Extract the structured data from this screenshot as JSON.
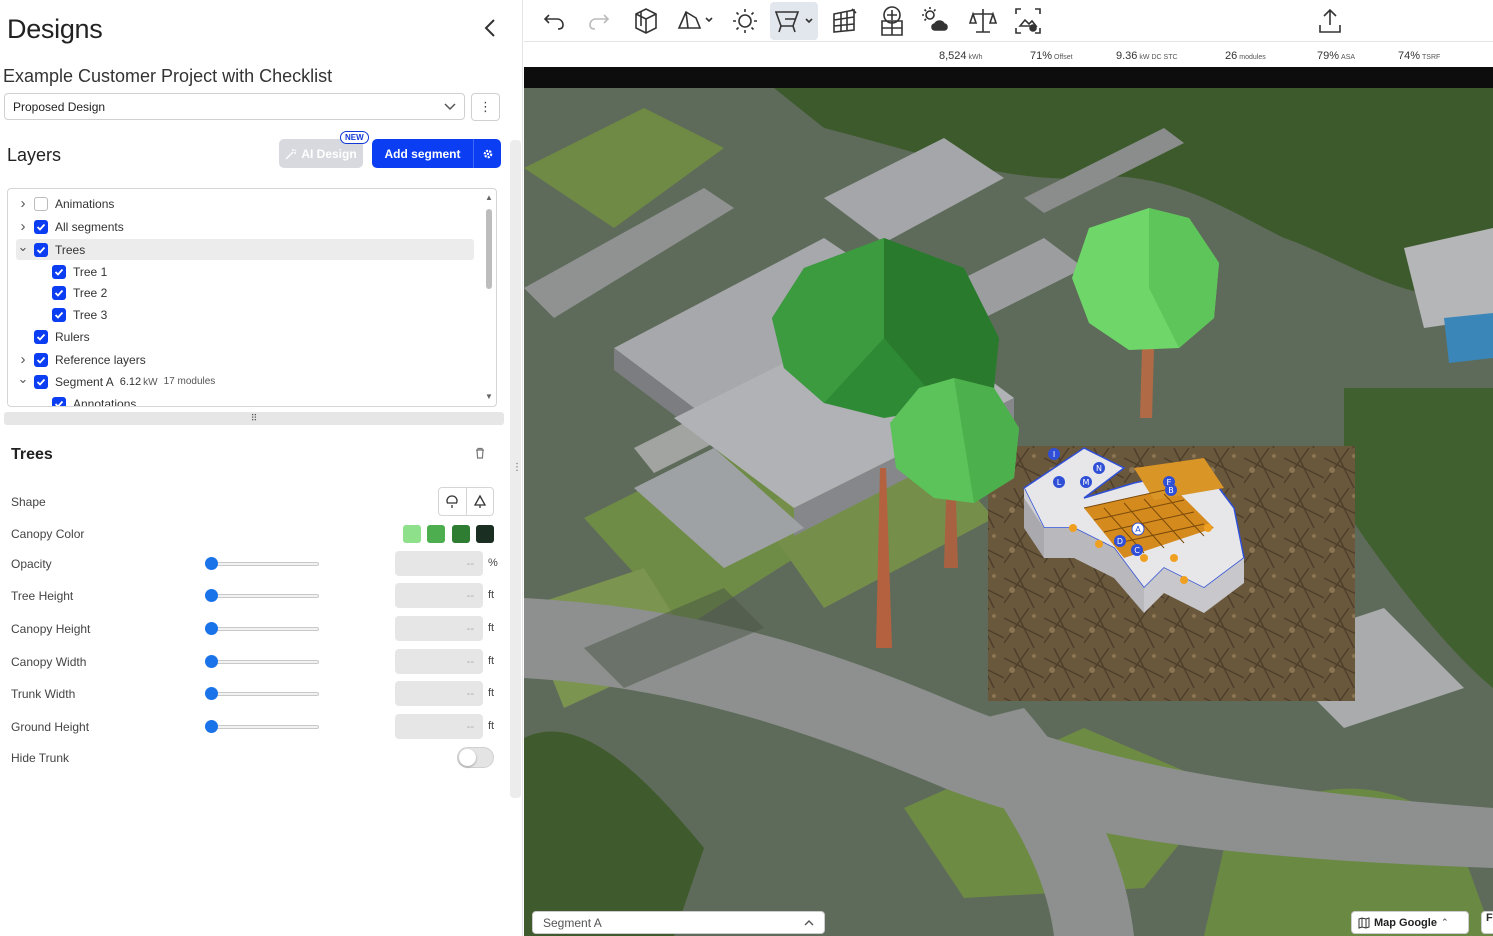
{
  "header": {
    "title": "Designs",
    "project_name": "Example Customer Project with Checklist"
  },
  "design_select": {
    "value": "Proposed Design"
  },
  "layers": {
    "title": "Layers",
    "ai_design_label": "AI Design",
    "new_badge": "NEW",
    "add_segment_label": "Add segment",
    "items": [
      {
        "label": "Animations",
        "checked": false,
        "expand": "collapsed"
      },
      {
        "label": "All segments",
        "checked": true,
        "expand": "collapsed"
      },
      {
        "label": "Trees",
        "checked": true,
        "expand": "expanded",
        "selected": true
      },
      {
        "label": "Tree 1",
        "checked": true,
        "expand": "none"
      },
      {
        "label": "Tree 2",
        "checked": true,
        "expand": "none"
      },
      {
        "label": "Tree 3",
        "checked": true,
        "expand": "none"
      },
      {
        "label": "Rulers",
        "checked": true,
        "expand": "none"
      },
      {
        "label": "Reference layers",
        "checked": true,
        "expand": "collapsed"
      },
      {
        "label": "Segment A",
        "checked": true,
        "expand": "expanded",
        "kw": "6.12",
        "kw_unit": "kW",
        "modules": "17 modules"
      },
      {
        "label": "Annotations",
        "checked": true,
        "expand": "none"
      }
    ]
  },
  "properties": {
    "title": "Trees",
    "shape_label": "Shape",
    "canopy_color_label": "Canopy Color",
    "canopy_colors": [
      "#8fe08a",
      "#4cae4f",
      "#2e7d32",
      "#1b2e22"
    ],
    "sliders": [
      {
        "label": "Opacity",
        "value": "--",
        "unit": "%"
      },
      {
        "label": "Tree Height",
        "value": "--",
        "unit": "ft"
      },
      {
        "label": "Canopy Height",
        "value": "--",
        "unit": "ft"
      },
      {
        "label": "Canopy Width",
        "value": "--",
        "unit": "ft"
      },
      {
        "label": "Trunk Width",
        "value": "--",
        "unit": "ft"
      },
      {
        "label": "Ground Height",
        "value": "--",
        "unit": "ft"
      }
    ],
    "hide_trunk_label": "Hide Trunk",
    "hide_trunk_on": false
  },
  "toolbar": {
    "icons": [
      "undo-icon",
      "redo-icon",
      "3d-box-icon",
      "roof-shape-icon",
      "sun-shading-icon",
      "panel-placement-icon",
      "panel-grid-icon",
      "module-layout-icon",
      "weather-icon",
      "balance-icon",
      "image-export-icon",
      "upload-icon"
    ]
  },
  "stats": [
    {
      "value": "8,524",
      "unit": "kWh"
    },
    {
      "value": "71%",
      "unit": "Offset"
    },
    {
      "value": "9.36",
      "unit": "kW DC STC"
    },
    {
      "value": "26",
      "unit": "modules"
    },
    {
      "value": "79%",
      "unit": "ASA"
    },
    {
      "value": "74%",
      "unit": "TSRF"
    }
  ],
  "map": {
    "segment_select": "Segment A",
    "map_button": "Map Google",
    "edge_button": "F",
    "roof_labels": [
      "I",
      "N",
      "L",
      "M",
      "E",
      "B",
      "A",
      "D",
      "C"
    ]
  }
}
